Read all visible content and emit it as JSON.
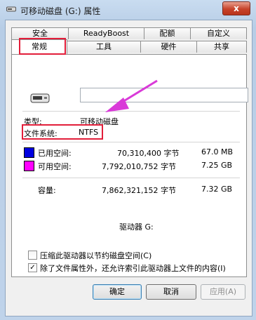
{
  "window": {
    "title": "可移动磁盘 (G:) 属性",
    "close_label": "x"
  },
  "tabs": {
    "row_back": [
      "安全",
      "ReadyBoost",
      "配额",
      "自定义"
    ],
    "row_front": [
      "常规",
      "工具",
      "硬件",
      "共享"
    ],
    "selected": "常规"
  },
  "general": {
    "type_label": "类型:",
    "type_value": "可移动磁盘",
    "fs_label": "文件系统:",
    "fs_value": "NTFS",
    "used": {
      "label": "已用空间:",
      "bytes": "70,310,400 字节",
      "size": "67.0 MB"
    },
    "free": {
      "label": "可用空间:",
      "bytes": "7,792,010,752 字节",
      "size": "7.25 GB"
    },
    "capacity": {
      "label": "容量:",
      "bytes": "7,862,321,152 字节",
      "size": "7.32 GB"
    },
    "drive_label": "驱动器 G:",
    "compress_label": "压缩此驱动器以节约磁盘空间(C)",
    "compress_checked": false,
    "index_label": "除了文件属性外，还允许索引此驱动器上文件的内容(I)",
    "index_checked": true
  },
  "colors": {
    "used": "#0000e0",
    "free": "#ff00ff",
    "highlight": "#e21e3a",
    "arrow": "#d93ad8"
  },
  "buttons": {
    "ok": "确定",
    "cancel": "取消",
    "apply": "应用(A)"
  }
}
